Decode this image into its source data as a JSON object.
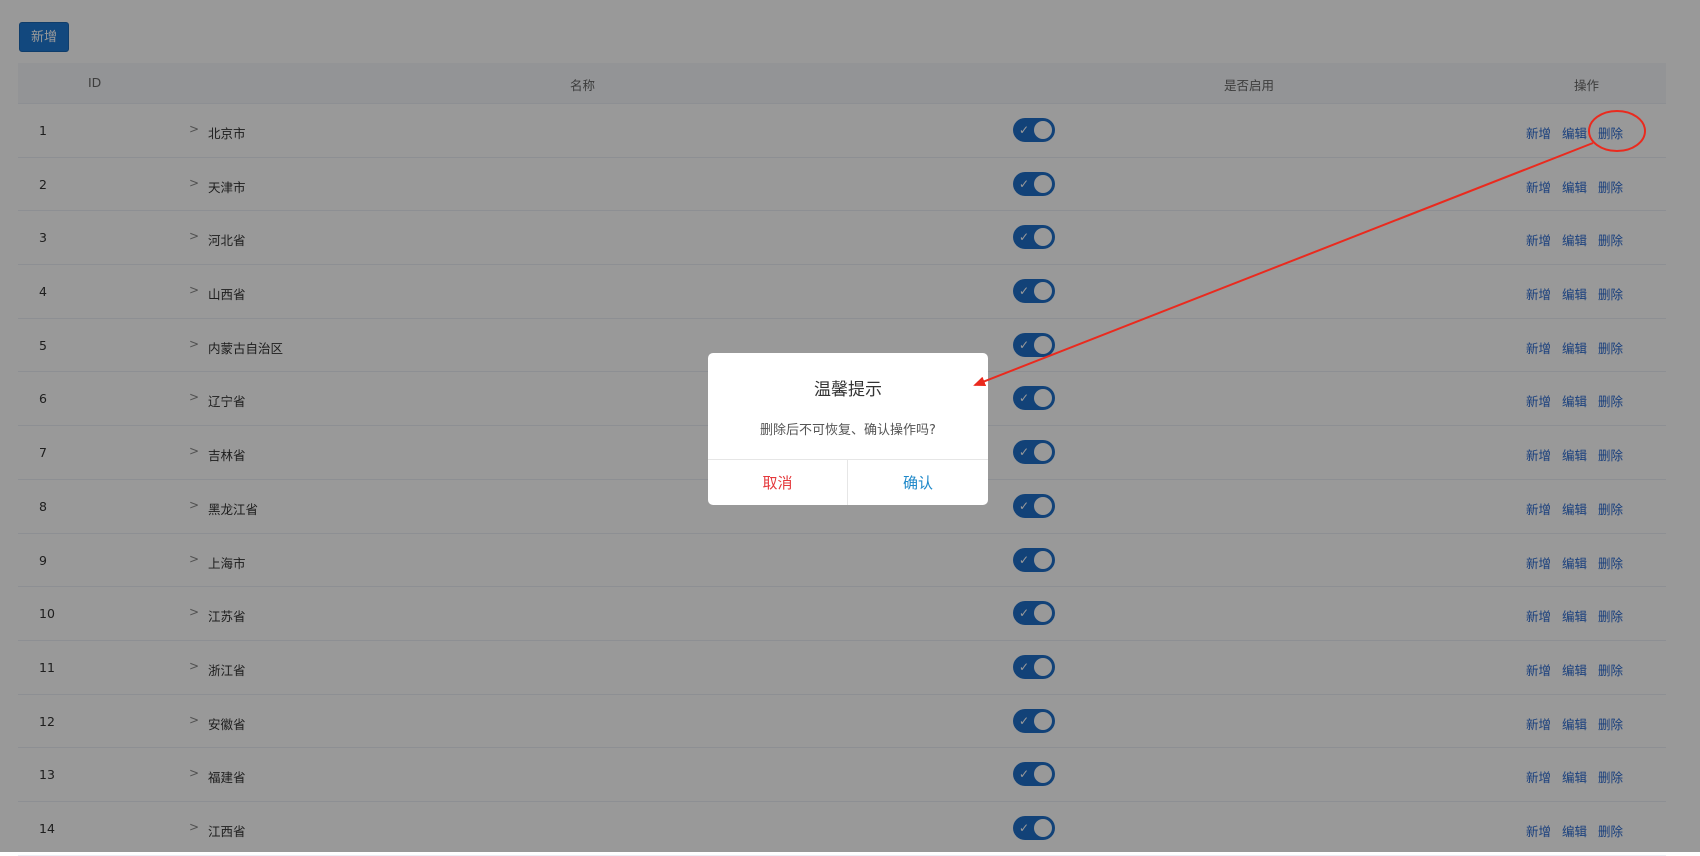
{
  "toolbar": {
    "add_label": "新增"
  },
  "table": {
    "headers": {
      "id": "ID",
      "name": "名称",
      "enabled": "是否启用",
      "actions": "操作"
    },
    "rows": [
      {
        "id": "1",
        "name": "北京市"
      },
      {
        "id": "2",
        "name": "天津市"
      },
      {
        "id": "3",
        "name": "河北省"
      },
      {
        "id": "4",
        "name": "山西省"
      },
      {
        "id": "5",
        "name": "内蒙古自治区"
      },
      {
        "id": "6",
        "name": "辽宁省"
      },
      {
        "id": "7",
        "name": "吉林省"
      },
      {
        "id": "8",
        "name": "黑龙江省"
      },
      {
        "id": "9",
        "name": "上海市"
      },
      {
        "id": "10",
        "name": "江苏省"
      },
      {
        "id": "11",
        "name": "浙江省"
      },
      {
        "id": "12",
        "name": "安徽省"
      },
      {
        "id": "13",
        "name": "福建省"
      },
      {
        "id": "14",
        "name": "江西省"
      }
    ],
    "row_actions": {
      "add": "新增",
      "edit": "编辑",
      "delete": "删除"
    },
    "expand_icon": "chevron-right-icon",
    "toggle_icon": "check-icon"
  },
  "dialog": {
    "title": "温馨提示",
    "message": "删除后不可恢复、确认操作吗?",
    "cancel_label": "取消",
    "confirm_label": "确认"
  },
  "colors": {
    "primary": "#1e78d2",
    "link": "#2a6ad0",
    "cancel": "#e4393c",
    "confirm": "#1e88c9",
    "annotation": "#ea2a1e"
  }
}
